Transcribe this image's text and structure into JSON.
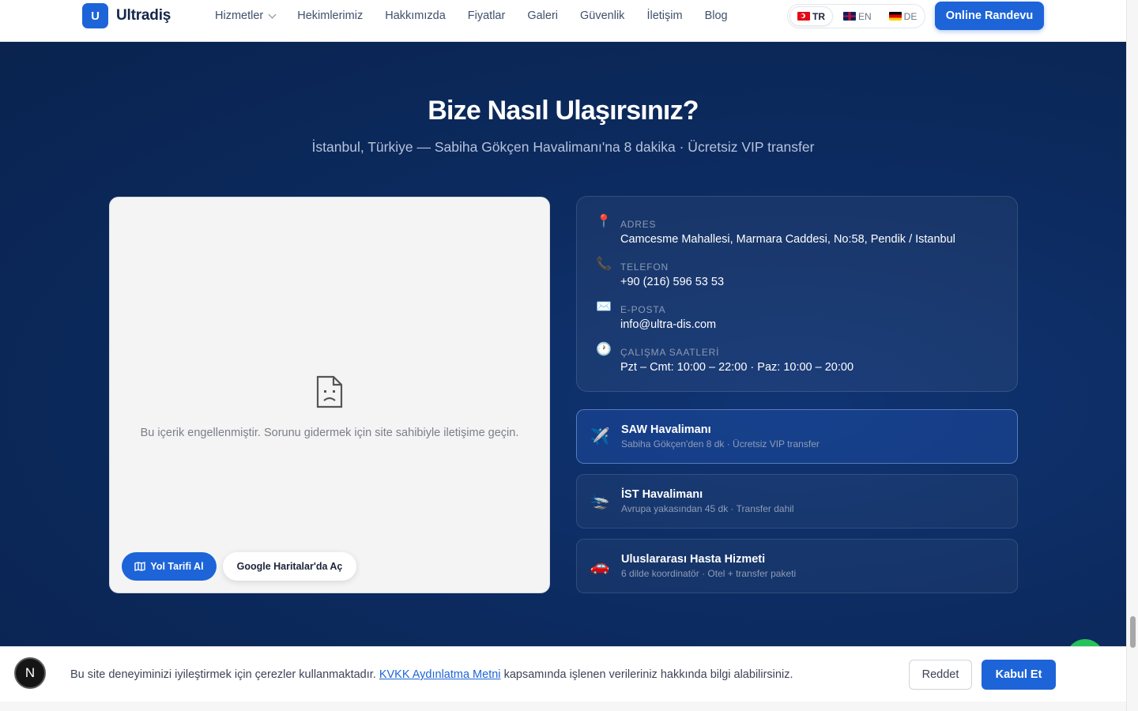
{
  "header": {
    "logo_letter": "U",
    "logo_text": "Ultradiş",
    "nav": [
      "Hizmetler",
      "Hekimlerimiz",
      "Hakkımızda",
      "Fiyatlar",
      "Galeri",
      "Güvenlik",
      "İletişim",
      "Blog"
    ],
    "languages": [
      {
        "code": "TR",
        "active": true
      },
      {
        "code": "EN",
        "active": false
      },
      {
        "code": "DE",
        "active": false
      }
    ],
    "cta_label": "Online Randevu",
    "accent_color": "#1d64d8"
  },
  "section": {
    "title": "Bize Nasıl Ulaşırsınız?",
    "subtitle": "İstanbul, Türkiye — Sabiha Gökçen Havalimanı'na 8 dakika · Ücretsiz VIP transfer",
    "background_color": "#0c2b60"
  },
  "map": {
    "blocked_message": "Bu içerik engellenmiştir. Sorunu gidermek için site sahibiyle iletişime geçin.",
    "directions_label": "Yol Tarifi Al",
    "open_maps_label": "Google Haritalar'da Aç"
  },
  "contact": {
    "address": {
      "icon": "map-pin-icon",
      "label": "ADRES",
      "value": "Camcesme Mahallesi, Marmara Caddesi, No:58, Pendik / Istanbul"
    },
    "phone": {
      "icon": "phone-icon",
      "label": "TELEFON",
      "value": "+90 (216) 596 53 53"
    },
    "email": {
      "icon": "envelope-icon",
      "label": "E-POSTA",
      "value": "info@ultra-dis.com"
    },
    "hours": {
      "icon": "clock-icon",
      "label": "ÇALIŞMA SAATLERİ",
      "value": "Pzt – Cmt: 10:00 – 22:00 · Paz: 10:00 – 20:00"
    }
  },
  "transport": [
    {
      "icon": "airplane-icon",
      "title": "SAW Havalimanı",
      "subtitle": "Sabiha Gökçen'den 8 dk · Ücretsiz VIP transfer",
      "highlighted": true
    },
    {
      "icon": "airplane-landing-icon",
      "title": "İST Havalimanı",
      "subtitle": "Avrupa yakasından 45 dk · Transfer dahil",
      "highlighted": false
    },
    {
      "icon": "car-icon",
      "title": "Uluslararası Hasta Hizmeti",
      "subtitle": "6 dilde koordinatör · Otel + transfer paketi",
      "highlighted": false
    }
  ],
  "cookie": {
    "badge_letter": "N",
    "text_before": "Bu site deneyiminizi iyileştirmek için çerezler kullanmaktadır.",
    "link_text": "KVKK Aydınlatma Metni",
    "text_after": "kapsamında işlenen verileriniz hakkında bilgi alabilirsiniz.",
    "reject_label": "Reddet",
    "accept_label": "Kabul Et"
  }
}
